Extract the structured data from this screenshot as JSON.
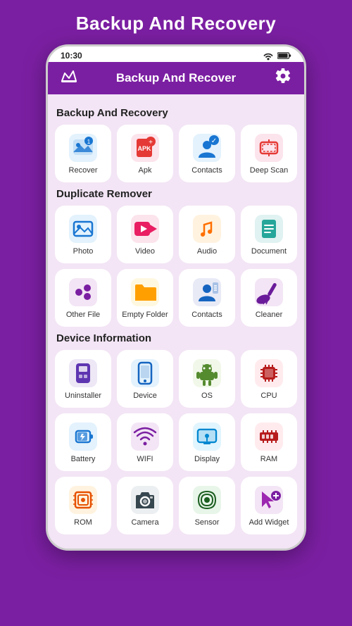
{
  "page": {
    "title": "Backup And Recovery",
    "status_bar": {
      "time": "10:30",
      "wifi": true,
      "battery": true
    },
    "top_bar": {
      "title": "Backup And Recover",
      "crown_icon": "♛",
      "settings_icon": "⚙"
    },
    "sections": [
      {
        "id": "backup",
        "title": "Backup And Recovery",
        "items": [
          {
            "id": "recover",
            "label": "Recover"
          },
          {
            "id": "apk",
            "label": "Apk"
          },
          {
            "id": "contacts",
            "label": "Contacts"
          },
          {
            "id": "deepscan",
            "label": "Deep Scan"
          }
        ]
      },
      {
        "id": "duplicate",
        "title": "Duplicate Remover",
        "items": [
          {
            "id": "photo",
            "label": "Photo"
          },
          {
            "id": "video",
            "label": "Video"
          },
          {
            "id": "audio",
            "label": "Audio"
          },
          {
            "id": "document",
            "label": "Document"
          },
          {
            "id": "otherfile",
            "label": "Other File"
          },
          {
            "id": "emptyfolder",
            "label": "Empty Folder"
          },
          {
            "id": "contacts2",
            "label": "Contacts"
          },
          {
            "id": "cleaner",
            "label": "Cleaner"
          }
        ]
      },
      {
        "id": "device",
        "title": "Device Information",
        "items": [
          {
            "id": "uninstaller",
            "label": "Uninstaller"
          },
          {
            "id": "device",
            "label": "Device"
          },
          {
            "id": "os",
            "label": "OS"
          },
          {
            "id": "cpu",
            "label": "CPU"
          },
          {
            "id": "battery",
            "label": "Battery"
          },
          {
            "id": "wifi",
            "label": "WIFI"
          },
          {
            "id": "display",
            "label": "Display"
          },
          {
            "id": "ram",
            "label": "RAM"
          },
          {
            "id": "rom",
            "label": "ROM"
          },
          {
            "id": "camera",
            "label": "Camera"
          },
          {
            "id": "sensor",
            "label": "Sensor"
          },
          {
            "id": "addwidget",
            "label": "Add Widget"
          }
        ]
      }
    ]
  }
}
